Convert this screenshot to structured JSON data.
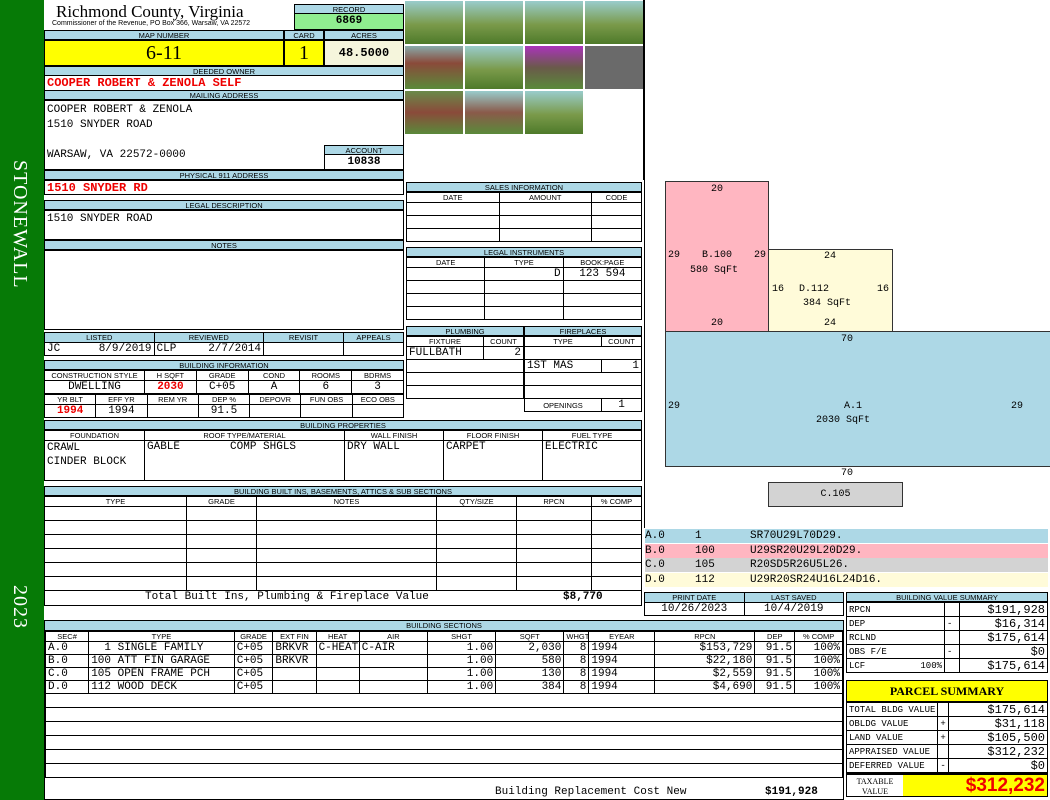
{
  "district": "STONEWALL",
  "year": "2023",
  "header": {
    "title": "Richmond County, Virginia",
    "subtitle": "Commissioner of the Revenue, PO Box 366, Warsaw, VA 22572",
    "record_label": "RECORD",
    "record": "6869"
  },
  "map": {
    "map_label": "MAP NUMBER",
    "map_number": "6-11",
    "card_label": "CARD",
    "card": "1",
    "acres_label": "ACRES",
    "acres": "48.5000"
  },
  "owner": {
    "label": "DEEDED OWNER",
    "name": "COOPER ROBERT & ZENOLA SELF"
  },
  "mailing": {
    "label": "MAILING ADDRESS",
    "line1": "COOPER ROBERT & ZENOLA",
    "line2": "1510 SNYDER ROAD",
    "line3": "WARSAW, VA 22572-0000",
    "account_label": "ACCOUNT",
    "account": "10838"
  },
  "physical": {
    "label": "PHYSICAL 911 ADDRESS",
    "value": "1510 SNYDER RD"
  },
  "legal": {
    "label": "LEGAL DESCRIPTION",
    "value": "1510 SNYDER ROAD"
  },
  "notes": {
    "label": "NOTES"
  },
  "sales": {
    "label": "SALES INFORMATION",
    "cols": [
      "DATE",
      "AMOUNT",
      "CODE"
    ]
  },
  "instruments": {
    "label": "LEGAL INSTRUMENTS",
    "cols": [
      "DATE",
      "TYPE",
      "BOOK:PAGE"
    ],
    "rows": [
      [
        "",
        "D",
        "123 594"
      ]
    ]
  },
  "listed": {
    "cols": [
      "LISTED",
      "REVIEWED",
      "REVISIT",
      "APPEALS"
    ],
    "listed_by": "JC",
    "listed_date": "8/9/2019",
    "reviewed_by": "CLP",
    "reviewed_date": "2/7/2014"
  },
  "bldg_info": {
    "label": "BUILDING INFORMATION",
    "cols1": [
      "CONSTRUCTION STYLE",
      "H SQFT",
      "GRADE",
      "COND",
      "ROOMS",
      "BDRMS"
    ],
    "vals1": [
      "DWELLING",
      "2030",
      "C+05",
      "A",
      "6",
      "3"
    ],
    "cols2": [
      "YR BLT",
      "EFF YR",
      "REM YR",
      "DEP %",
      "DEPOVR",
      "FUN OBS",
      "ECO OBS"
    ],
    "vals2": [
      "1994",
      "1994",
      "",
      "91.5",
      "",
      "",
      ""
    ]
  },
  "plumbing": {
    "label": "PLUMBING",
    "cols": [
      "FIXTURE",
      "COUNT"
    ],
    "rows": [
      [
        "FULLBATH",
        "2"
      ]
    ]
  },
  "fireplaces": {
    "label": "FIREPLACES",
    "cols": [
      "TYPE",
      "COUNT"
    ],
    "rows": [
      [
        "1ST MAS",
        "1"
      ]
    ],
    "openings_label": "OPENINGS",
    "openings": "1"
  },
  "properties": {
    "label": "BUILDING PROPERTIES",
    "cols": [
      "FOUNDATION",
      "ROOF TYPE/MATERIAL",
      "WALL FINISH",
      "FLOOR FINISH",
      "FUEL TYPE"
    ],
    "foundation": [
      "CRAWL",
      "CINDER BLOCK"
    ],
    "roof_type": "GABLE",
    "roof_material": "COMP SHGLS",
    "wall": "DRY WALL",
    "floor": "CARPET",
    "fuel": "ELECTRIC"
  },
  "builtins": {
    "label": "BUILDING BUILT INS, BASEMENTS, ATTICS & SUB SECTIONS",
    "cols": [
      "TYPE",
      "GRADE",
      "NOTES",
      "QTY/SIZE",
      "RPCN",
      "% COMP"
    ],
    "total_label": "Total Built Ins, Plumbing & Fireplace Value",
    "total": "$8,770"
  },
  "dates": {
    "print_label": "PRINT DATE",
    "print": "10/26/2023",
    "saved_label": "LAST SAVED",
    "saved": "10/4/2019"
  },
  "sections": {
    "label": "BUILDING SECTIONS",
    "cols": [
      "SEC#",
      "TYPE",
      "GRADE",
      "EXT FIN",
      "HEAT",
      "AIR",
      "SHGT",
      "SQFT",
      "WHGT",
      "EYEAR",
      "RPCN",
      "DEP",
      "% COMP"
    ],
    "rows": [
      [
        "A.0",
        "  1 SINGLE FAMILY",
        "C+05",
        "BRKVR",
        "C-HEAT",
        "C-AIR",
        "1.00",
        "2,030",
        "8",
        "1994",
        "$153,729",
        "91.5",
        "100%"
      ],
      [
        "B.0",
        "100 ATT FIN GARAGE",
        "C+05",
        "BRKVR",
        "",
        "",
        "1.00",
        "580",
        "8",
        "1994",
        "$22,180",
        "91.5",
        "100%"
      ],
      [
        "C.0",
        "105 OPEN FRAME PCH",
        "C+05",
        "",
        "",
        "",
        "1.00",
        "130",
        "8",
        "1994",
        "$2,559",
        "91.5",
        "100%"
      ],
      [
        "D.0",
        "112 WOOD DECK",
        "C+05",
        "",
        "",
        "",
        "1.00",
        "384",
        "8",
        "1994",
        "$4,690",
        "91.5",
        "100%"
      ]
    ],
    "total_label": "Building Replacement Cost New",
    "total": "$191,928"
  },
  "value_summary": {
    "label": "BUILDING VALUE SUMMARY",
    "rows": [
      [
        "RPCN",
        "",
        "$191,928"
      ],
      [
        "DEP",
        "-",
        "$16,314"
      ],
      [
        "RCLND",
        "",
        "$175,614"
      ],
      [
        "OBS F/E",
        "-",
        "$0"
      ],
      [
        "LCF",
        "100%",
        "$175,614"
      ]
    ]
  },
  "parcel": {
    "label": "PARCEL SUMMARY",
    "rows": [
      [
        "TOTAL BLDG VALUE",
        "",
        "$175,614"
      ],
      [
        "OBLDG VALUE",
        "+",
        "$31,118"
      ],
      [
        "LAND VALUE",
        "+",
        "$105,500"
      ],
      [
        "APPRAISED VALUE",
        "",
        "$312,232"
      ],
      [
        "DEFERRED VALUE",
        "-",
        "$0"
      ]
    ],
    "taxable_label": "TAXABLE VALUE",
    "taxable": "$312,232"
  },
  "sketch": {
    "areas": [
      {
        "code": "B.100",
        "sqft": "580 SqFt",
        "dims": [
          "20",
          "29",
          "29",
          "20"
        ],
        "color": "#ffb6c1"
      },
      {
        "code": "D.112",
        "sqft": "384 SqFt",
        "dims": [
          "24",
          "16",
          "16",
          "24"
        ],
        "color": "#fffbd9"
      },
      {
        "code": "A.1",
        "sqft": "2030 SqFt",
        "dims": [
          "70",
          "29",
          "29",
          "70"
        ],
        "color": "#add8e6"
      },
      {
        "code": "C.105",
        "color": "#d3d3d3"
      }
    ],
    "legend": [
      [
        "A.0",
        "1",
        "SR70U29L70D29.",
        "#add8e6"
      ],
      [
        "B.0",
        "100",
        "U29SR20U29L20D29.",
        "#ffb6c1"
      ],
      [
        "C.0",
        "105",
        "R20SD5R26U5L26.",
        "#d3d3d3"
      ],
      [
        "D.0",
        "112",
        "U29R20SR24U16L24D16.",
        "#fffbd9"
      ]
    ]
  }
}
